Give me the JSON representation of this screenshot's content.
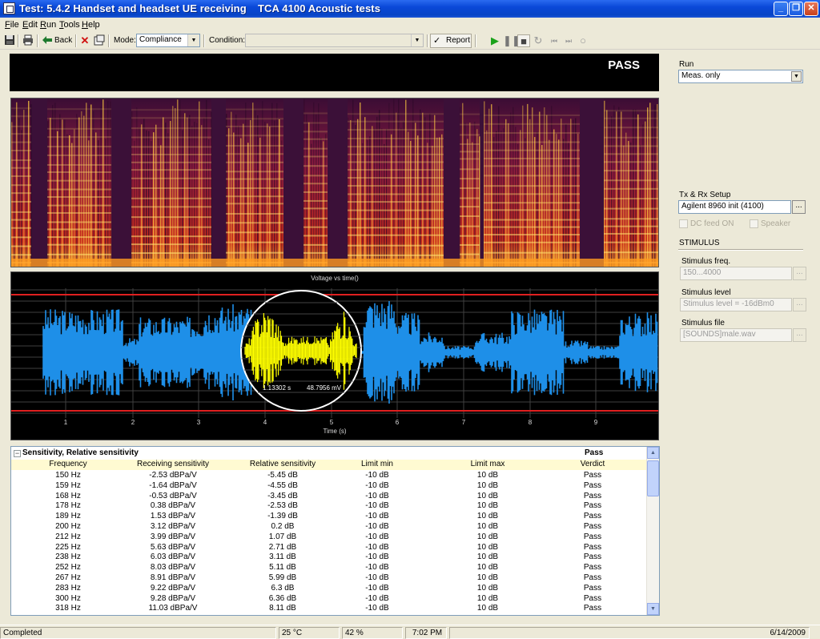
{
  "window": {
    "title_left": "Test: 5.4.2 Handset and headset UE receiving",
    "title_center": "TCA 4100 Acoustic tests",
    "minimize": "_",
    "maximize": "❐",
    "close": "✕"
  },
  "menu": [
    {
      "key": "F",
      "rest": "ile"
    },
    {
      "key": "E",
      "rest": "dit"
    },
    {
      "key": "R",
      "rest": "un"
    },
    {
      "key": "T",
      "rest": "ools"
    },
    {
      "key": "H",
      "rest": "elp"
    }
  ],
  "toolbar": {
    "back_label": "Back",
    "mode_label": "Mode:",
    "mode_value": "Compliance",
    "condition_label": "Condition:",
    "condition_value": "",
    "report_label": "Report",
    "icons": [
      "save-icon",
      "print-icon",
      "back-arrow-icon",
      "delete-icon",
      "properties-icon",
      "check-icon",
      "play-icon",
      "pause-icon",
      "stop-icon",
      "loop-icon",
      "skip-back-icon",
      "skip-forward-icon",
      "record-icon"
    ]
  },
  "banner": {
    "result": "PASS"
  },
  "waveform": {
    "title": "Voltage vs time()",
    "xlabel": "Time (s)",
    "ticks": [
      "1",
      "2",
      "3",
      "4",
      "5",
      "6",
      "7",
      "8",
      "9"
    ],
    "cursor_time": "1.13302 s",
    "cursor_voltage": "48.7956 mV",
    "colors": {
      "signal": "#1e8fe8",
      "highlight": "#ffff00",
      "limits": "#ff2020",
      "grid": "#404040"
    }
  },
  "spectrogram": {
    "colors": {
      "low": "#2a0b28",
      "mid": "#c0202a",
      "high": "#ffd040"
    }
  },
  "results": {
    "section_title": "Sensitivity, Relative sensitivity",
    "section_verdict": "Pass",
    "columns": [
      "Frequency",
      "Receiving sensitivity",
      "Relative sensitivity",
      "Limit min",
      "Limit max",
      "Verdict"
    ],
    "rows": [
      [
        "150 Hz",
        "-2.53 dBPa/V",
        "-5.45 dB",
        "-10 dB",
        "10 dB",
        "Pass"
      ],
      [
        "159 Hz",
        "-1.64 dBPa/V",
        "-4.55 dB",
        "-10 dB",
        "10 dB",
        "Pass"
      ],
      [
        "168 Hz",
        "-0.53 dBPa/V",
        "-3.45 dB",
        "-10 dB",
        "10 dB",
        "Pass"
      ],
      [
        "178 Hz",
        "0.38 dBPa/V",
        "-2.53 dB",
        "-10 dB",
        "10 dB",
        "Pass"
      ],
      [
        "189 Hz",
        "1.53 dBPa/V",
        "-1.39 dB",
        "-10 dB",
        "10 dB",
        "Pass"
      ],
      [
        "200 Hz",
        "3.12 dBPa/V",
        "0.2 dB",
        "-10 dB",
        "10 dB",
        "Pass"
      ],
      [
        "212 Hz",
        "3.99 dBPa/V",
        "1.07 dB",
        "-10 dB",
        "10 dB",
        "Pass"
      ],
      [
        "225 Hz",
        "5.63 dBPa/V",
        "2.71 dB",
        "-10 dB",
        "10 dB",
        "Pass"
      ],
      [
        "238 Hz",
        "6.03 dBPa/V",
        "3.11 dB",
        "-10 dB",
        "10 dB",
        "Pass"
      ],
      [
        "252 Hz",
        "8.03 dBPa/V",
        "5.11 dB",
        "-10 dB",
        "10 dB",
        "Pass"
      ],
      [
        "267 Hz",
        "8.91 dBPa/V",
        "5.99 dB",
        "-10 dB",
        "10 dB",
        "Pass"
      ],
      [
        "283 Hz",
        "9.22 dBPa/V",
        "6.3 dB",
        "-10 dB",
        "10 dB",
        "Pass"
      ],
      [
        "300 Hz",
        "9.28 dBPa/V",
        "6.36 dB",
        "-10 dB",
        "10 dB",
        "Pass"
      ],
      [
        "318 Hz",
        "11.03 dBPa/V",
        "8.11 dB",
        "-10 dB",
        "10 dB",
        "Pass"
      ]
    ]
  },
  "right_panel": {
    "run_label": "Run",
    "run_value": "Meas. only",
    "setup_label": "Tx & Rx Setup",
    "setup_value": "Agilent 8960 init (4100)",
    "dc_feed_label": "DC feed ON",
    "speaker_label": "Speaker",
    "stimulus_heading": "STIMULUS",
    "freq_label": "Stimulus freq.",
    "freq_value": "150...4000",
    "level_label": "Stimulus level",
    "level_value": "Stimulus level = -16dBm0",
    "file_label": "Stimulus file",
    "file_value": "[SOUNDS]male.wav",
    "browse": "..."
  },
  "status": {
    "state": "Completed",
    "temperature": "25 °C",
    "humidity": "42 %",
    "time": "7:02 PM",
    "date": "6/14/2009"
  }
}
